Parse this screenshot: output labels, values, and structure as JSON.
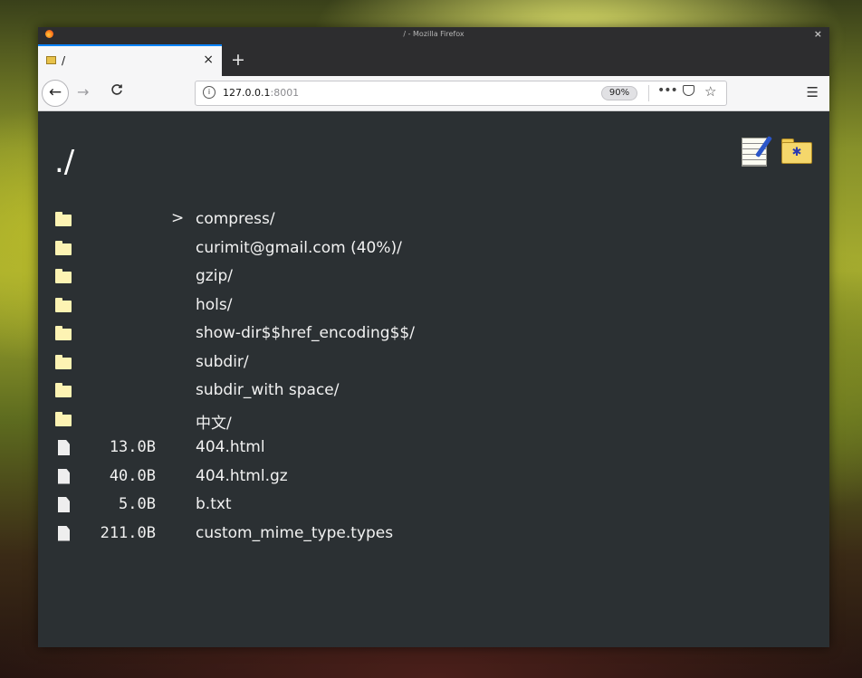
{
  "window": {
    "title": "/ - Mozilla Firefox"
  },
  "tab": {
    "title": "/",
    "close": "×",
    "new_tab": "+"
  },
  "navbar": {
    "back": "←",
    "forward": "→",
    "reload": "C",
    "url_host": "127.0.0.1",
    "url_port": ":8001",
    "zoom": "90%",
    "page_actions": "•••",
    "menu": "☰"
  },
  "page": {
    "title": "./"
  },
  "icons": {
    "notepad": "notepad-icon",
    "new_folder": "new-folder-icon",
    "folder": "folder-icon",
    "file": "file-icon"
  },
  "listing": [
    {
      "type": "folder",
      "size": "",
      "name": "compress/",
      "marker": ">"
    },
    {
      "type": "folder",
      "size": "",
      "name": "curimit@gmail.com (40%)/",
      "marker": ""
    },
    {
      "type": "folder",
      "size": "",
      "name": "gzip/",
      "marker": ""
    },
    {
      "type": "folder",
      "size": "",
      "name": "hols/",
      "marker": ""
    },
    {
      "type": "folder",
      "size": "",
      "name": "show-dir$$href_encoding$$/",
      "marker": ""
    },
    {
      "type": "folder",
      "size": "",
      "name": "subdir/",
      "marker": ""
    },
    {
      "type": "folder",
      "size": "",
      "name": "subdir_with space/",
      "marker": ""
    },
    {
      "type": "folder",
      "size": "",
      "name": "中文/",
      "marker": ""
    },
    {
      "type": "file",
      "size": "13.0B",
      "name": "404.html",
      "marker": ""
    },
    {
      "type": "file",
      "size": "40.0B",
      "name": "404.html.gz",
      "marker": ""
    },
    {
      "type": "file",
      "size": "5.0B",
      "name": "b.txt",
      "marker": ""
    },
    {
      "type": "file",
      "size": "211.0B",
      "name": "custom_mime_type.types",
      "marker": ""
    }
  ]
}
